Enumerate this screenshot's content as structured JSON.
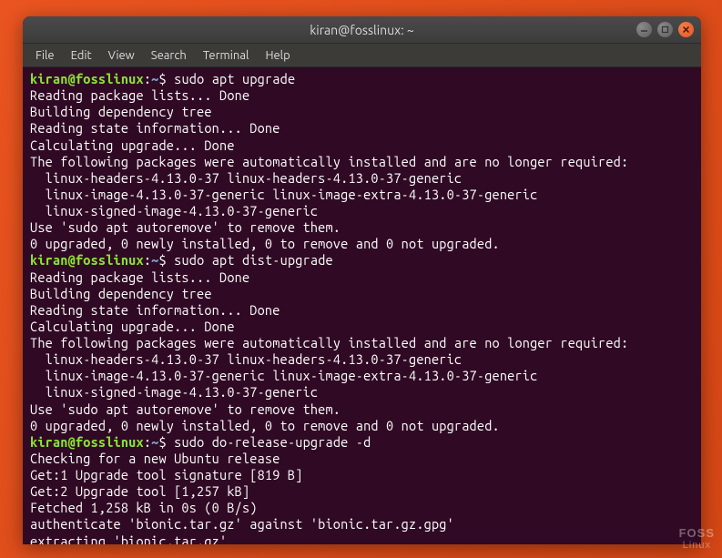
{
  "window": {
    "title": "kiran@fosslinux: ~"
  },
  "menubar": {
    "items": [
      "File",
      "Edit",
      "View",
      "Search",
      "Terminal",
      "Help"
    ]
  },
  "prompt": {
    "user": "kiran",
    "host": "fosslinux",
    "path": "~",
    "sep_at": "@",
    "sep_colon": ":",
    "dollar": "$"
  },
  "commands": {
    "c1": "sudo apt upgrade",
    "c2": "sudo apt dist-upgrade",
    "c3": "sudo do-release-upgrade -d"
  },
  "output": {
    "l1": "Reading package lists... Done",
    "l2": "Building dependency tree",
    "l3": "Reading state information... Done",
    "l4": "Calculating upgrade... Done",
    "l5": "The following packages were automatically installed and are no longer required:",
    "l6": "  linux-headers-4.13.0-37 linux-headers-4.13.0-37-generic",
    "l7": "  linux-image-4.13.0-37-generic linux-image-extra-4.13.0-37-generic",
    "l8": "  linux-signed-image-4.13.0-37-generic",
    "l9": "Use 'sudo apt autoremove' to remove them.",
    "l10": "0 upgraded, 0 newly installed, 0 to remove and 0 not upgraded.",
    "l11": "Checking for a new Ubuntu release",
    "l12": "Get:1 Upgrade tool signature [819 B]",
    "l13": "Get:2 Upgrade tool [1,257 kB]",
    "l14": "Fetched 1,258 kB in 0s (0 B/s)",
    "l15": "authenticate 'bionic.tar.gz' against 'bionic.tar.gz.gpg'",
    "l16": "extracting 'bionic.tar.gz'"
  },
  "watermark": {
    "top": "FOSS",
    "bottom": "Linux"
  }
}
